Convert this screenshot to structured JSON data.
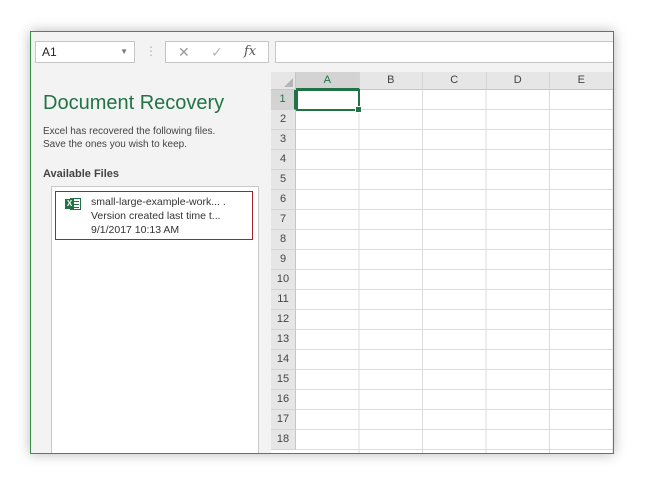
{
  "formula_bar": {
    "name_box": "A1",
    "cancel_icon": "close-icon",
    "enter_icon": "checkmark-icon",
    "function_label": "fx",
    "formula_value": ""
  },
  "recovery_pane": {
    "title": "Document Recovery",
    "description_line1": "Excel has recovered the following files.",
    "description_line2": "Save the ones you wish to keep.",
    "available_label": "Available Files",
    "files": [
      {
        "icon": "excel-file-icon",
        "name": "small-large-example-work... .",
        "version": "Version created last time t...",
        "timestamp": "9/1/2017 10:13 AM"
      }
    ]
  },
  "sheet": {
    "columns": [
      "A",
      "B",
      "C",
      "D",
      "E"
    ],
    "rows": [
      "1",
      "2",
      "3",
      "4",
      "5",
      "6",
      "7",
      "8",
      "9",
      "10",
      "11",
      "12",
      "13",
      "14",
      "15",
      "16",
      "17",
      "18"
    ],
    "active_cell": "A1"
  },
  "colors": {
    "accent": "#217346",
    "selection_border": "#a4262c"
  }
}
